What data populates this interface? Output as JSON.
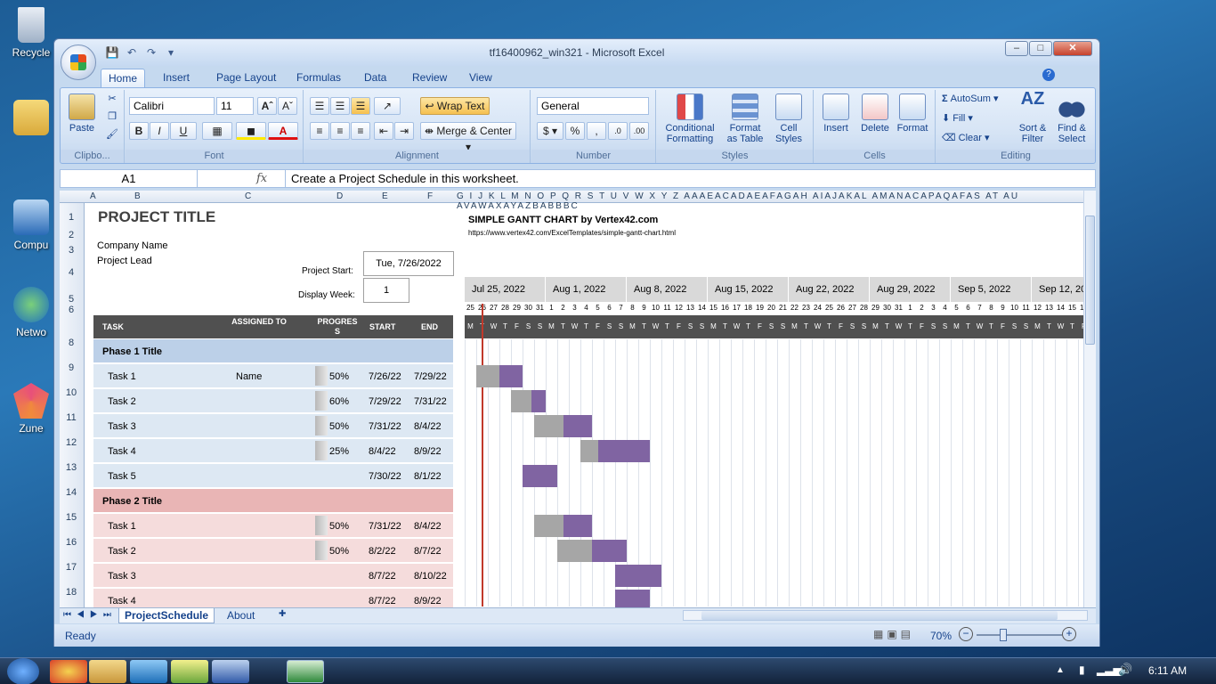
{
  "desktop": {
    "icons": [
      {
        "label": "Recycle"
      },
      {
        "label": ""
      },
      {
        "label": "Compu"
      },
      {
        "label": "Netwo"
      },
      {
        "label": "Zune"
      }
    ]
  },
  "window": {
    "title": "tf16400962_win321 - Microsoft Excel"
  },
  "tabs": [
    "Home",
    "Insert",
    "Page Layout",
    "Formulas",
    "Data",
    "Review",
    "View"
  ],
  "ribbon": {
    "clipboard": {
      "paste": "Paste",
      "label": "Clipbo..."
    },
    "font": {
      "name": "Calibri",
      "size": "11",
      "label": "Font"
    },
    "alignment": {
      "wrap": "Wrap Text",
      "merge": "Merge & Center",
      "label": "Alignment"
    },
    "number": {
      "format": "General",
      "label": "Number"
    },
    "styles": {
      "cond": "Conditional",
      "cond2": "Formatting",
      "fmt": "Format",
      "fmt2": "as Table",
      "cell": "Cell",
      "cell2": "Styles",
      "label": "Styles"
    },
    "cells": {
      "insert": "Insert",
      "delete": "Delete",
      "format": "Format",
      "label": "Cells"
    },
    "editing": {
      "autosum": "AutoSum",
      "fill": "Fill",
      "clear": "Clear",
      "sort": "Sort &",
      "sort2": "Filter",
      "find": "Find &",
      "find2": "Select",
      "label": "Editing"
    }
  },
  "formula": {
    "namebox": "A1",
    "fx": "fx",
    "content": "Create a Project Schedule in this worksheet."
  },
  "sheet": {
    "title": "PROJECT TITLE",
    "company": "Company Name",
    "lead": "Project Lead",
    "start_label": "Project Start:",
    "start_value": "Tue, 7/26/2022",
    "week_label": "Display Week:",
    "week_value": "1",
    "gantt_title": "SIMPLE GANTT CHART by Vertex42.com",
    "gantt_url": "https://www.vertex42.com/ExcelTemplates/simple-gantt-chart.html",
    "headers": {
      "task": "TASK",
      "assigned": "ASSIGNED TO",
      "progress": "PROGRESS",
      "start": "START",
      "end": "END"
    },
    "weeks": [
      "Jul 25, 2022",
      "Aug 1, 2022",
      "Aug 8, 2022",
      "Aug 15, 2022",
      "Aug 22, 2022",
      "Aug 29, 2022",
      "Sep 5, 2022",
      "Sep 12, 20"
    ],
    "rows": [
      {
        "r": "8",
        "type": "phase1",
        "task": "Phase 1 Title"
      },
      {
        "r": "9",
        "type": "p1",
        "task": "Task 1",
        "assigned": "Name",
        "progress": "50%",
        "start": "7/26/22",
        "end": "7/29/22"
      },
      {
        "r": "10",
        "type": "p1",
        "task": "Task 2",
        "assigned": "",
        "progress": "60%",
        "start": "7/29/22",
        "end": "7/31/22"
      },
      {
        "r": "11",
        "type": "p1",
        "task": "Task 3",
        "assigned": "",
        "progress": "50%",
        "start": "7/31/22",
        "end": "8/4/22"
      },
      {
        "r": "12",
        "type": "p1",
        "task": "Task 4",
        "assigned": "",
        "progress": "25%",
        "start": "8/4/22",
        "end": "8/9/22"
      },
      {
        "r": "13",
        "type": "p1",
        "task": "Task 5",
        "assigned": "",
        "progress": "",
        "start": "7/30/22",
        "end": "8/1/22"
      },
      {
        "r": "14",
        "type": "phase2",
        "task": "Phase 2 Title"
      },
      {
        "r": "15",
        "type": "p2",
        "task": "Task 1",
        "assigned": "",
        "progress": "50%",
        "start": "7/31/22",
        "end": "8/4/22"
      },
      {
        "r": "16",
        "type": "p2",
        "task": "Task 2",
        "assigned": "",
        "progress": "50%",
        "start": "8/2/22",
        "end": "8/7/22"
      },
      {
        "r": "17",
        "type": "p2",
        "task": "Task 3",
        "assigned": "",
        "progress": "",
        "start": "8/7/22",
        "end": "8/10/22"
      },
      {
        "r": "18",
        "type": "p2",
        "task": "Task 4",
        "assigned": "",
        "progress": "",
        "start": "8/7/22",
        "end": "8/9/22"
      }
    ]
  },
  "sheettabs": [
    "ProjectSchedule",
    "About"
  ],
  "status": {
    "ready": "Ready",
    "zoom": "70%"
  },
  "clock": "6:11 AM",
  "colors": {
    "phase1": "#bcd0e8",
    "p1": "#dde8f3",
    "phase2": "#e9b5b5",
    "p2": "#f5dcdc",
    "done": "#a6a6a6",
    "todo": "#8064a2",
    "header": "#505050"
  }
}
